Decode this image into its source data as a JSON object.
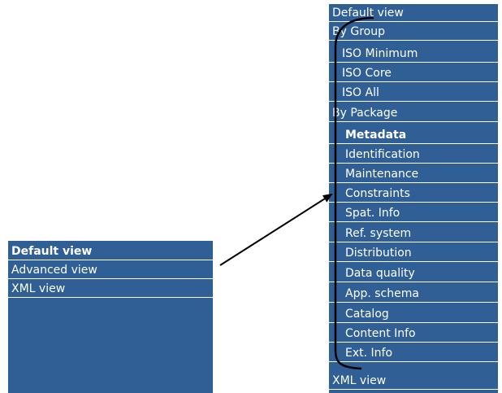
{
  "left_menu": {
    "items": [
      {
        "label": "Default view",
        "bold": true
      },
      {
        "label": "Advanced view",
        "bold": false
      },
      {
        "label": "XML view",
        "bold": false
      }
    ]
  },
  "right_menu": {
    "items": [
      {
        "label": "Default view",
        "level": 0,
        "bold": false
      },
      {
        "label": "By Group",
        "level": 0,
        "bold": false
      },
      {
        "label": "ISO Minimum",
        "level": 1,
        "bold": false
      },
      {
        "label": "ISO Core",
        "level": 1,
        "bold": false
      },
      {
        "label": "ISO All",
        "level": 1,
        "bold": false
      },
      {
        "label": "By Package",
        "level": 0,
        "bold": false
      },
      {
        "label": "Metadata",
        "level": 1,
        "bold": true
      },
      {
        "label": "Identification",
        "level": 1,
        "bold": false
      },
      {
        "label": "Maintenance",
        "level": 1,
        "bold": false
      },
      {
        "label": "Constraints",
        "level": 1,
        "bold": false
      },
      {
        "label": "Spat. Info",
        "level": 1,
        "bold": false
      },
      {
        "label": "Ref. system",
        "level": 1,
        "bold": false
      },
      {
        "label": "Distribution",
        "level": 1,
        "bold": false
      },
      {
        "label": "Data quality",
        "level": 1,
        "bold": false
      },
      {
        "label": "App. schema",
        "level": 1,
        "bold": false
      },
      {
        "label": "Catalog",
        "level": 1,
        "bold": false
      },
      {
        "label": "Content Info",
        "level": 1,
        "bold": false
      },
      {
        "label": "Ext. Info",
        "level": 1,
        "bold": false
      },
      {
        "label": "XML view",
        "level": 0,
        "bold": false
      }
    ]
  },
  "colors": {
    "menu_bg": "#2f5f95",
    "menu_text": "#ffffff",
    "separator": "#ffffff",
    "annotation": "#000000"
  }
}
